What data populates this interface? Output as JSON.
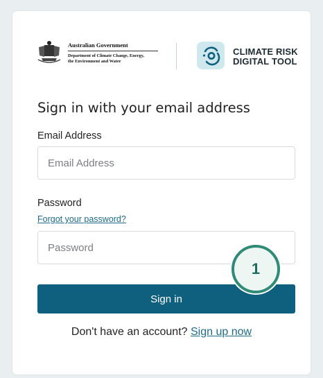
{
  "header": {
    "gov_logo": {
      "name": "Australian Government",
      "department_line1": "Department of Climate Change, Energy,",
      "department_line2": "the Environment and Water"
    },
    "product": {
      "name_line1": "CLIMATE RISK",
      "name_line2": "DIGITAL TOOL",
      "icon": "climate-risk-logo-icon"
    }
  },
  "form": {
    "title": "Sign in with your email address",
    "email": {
      "label": "Email Address",
      "placeholder": "Email Address",
      "value": ""
    },
    "password": {
      "label": "Password",
      "placeholder": "Password",
      "value": ""
    },
    "forgot_link": "Forgot your password?",
    "submit_label": "Sign in"
  },
  "signup": {
    "prompt": "Don't have an account?",
    "link": "Sign up now"
  },
  "annotation": {
    "step_number": "1"
  },
  "colors": {
    "primary": "#0f5f7e",
    "link": "#1f6a86",
    "badge_border": "#2f8a76",
    "logo_bg": "#cfe8ee"
  }
}
